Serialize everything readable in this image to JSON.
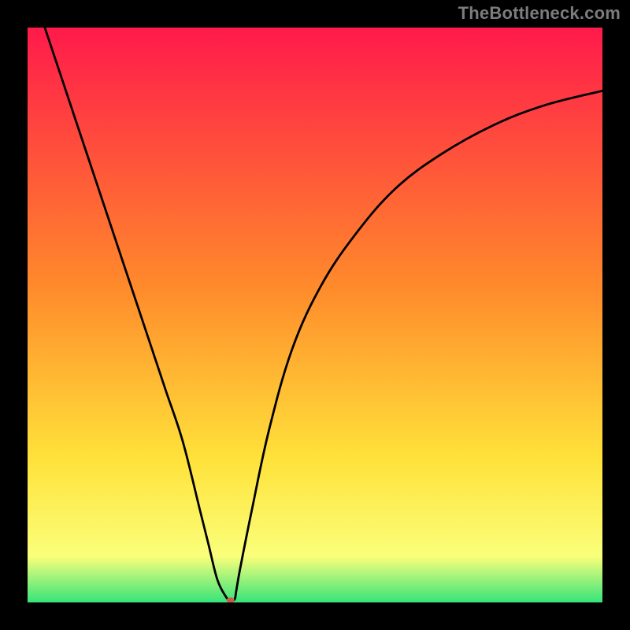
{
  "watermark": "TheBottleneck.com",
  "chart_data": {
    "type": "line",
    "title": "",
    "xlabel": "",
    "ylabel": "",
    "xlim": [
      0,
      100
    ],
    "ylim": [
      0,
      100
    ],
    "grid": false,
    "background_gradient": {
      "top": "#ff1a4b",
      "mid1": "#ff8a2b",
      "mid2": "#ffe23a",
      "bottom": "#36e47a"
    },
    "series": [
      {
        "name": "bottleneck-curve",
        "x": [
          3,
          6,
          9,
          12,
          15,
          18,
          21,
          24,
          27,
          30,
          31.5,
          33,
          34.5,
          35.2,
          36,
          36.3,
          37,
          39,
          42,
          46,
          51,
          57,
          64,
          72,
          81,
          90,
          100
        ],
        "y": [
          100,
          91,
          82,
          73,
          64,
          55,
          46,
          37,
          28,
          16,
          10,
          4,
          1,
          0.5,
          0.5,
          2,
          6,
          16,
          30,
          44,
          55,
          64,
          72,
          78,
          83,
          86.5,
          89
        ]
      }
    ],
    "marker": {
      "name": "optimal-point",
      "x": 35.3,
      "y": 0.4,
      "color": "#cc5a4a",
      "rx": 5,
      "ry": 3.5
    }
  }
}
